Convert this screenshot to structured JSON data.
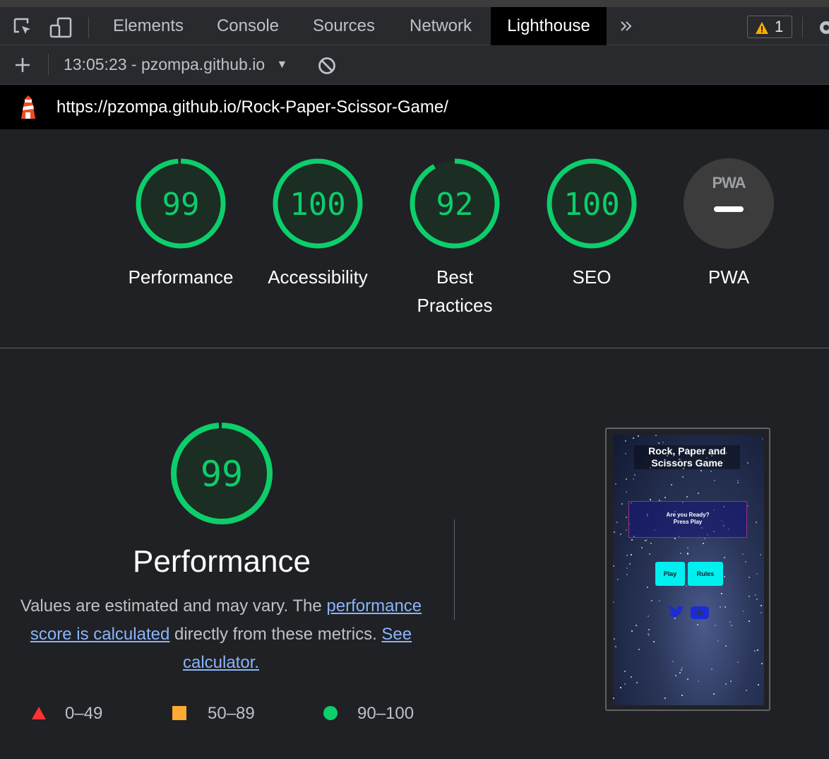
{
  "toolbar": {
    "tabs": [
      "Elements",
      "Console",
      "Sources",
      "Network",
      "Lighthouse"
    ],
    "more_icon": "chevron-double-right-icon",
    "warning_count": "1",
    "inspect_icon": "inspect-element-icon",
    "device_icon": "device-toggle-icon"
  },
  "report_bar": {
    "selector_label": "13:05:23 - pzompa.github.io",
    "add_icon": "plus-icon",
    "clear_icon": "block-icon"
  },
  "url": "https://pzompa.github.io/Rock-Paper-Scissor-Game/",
  "scores": [
    {
      "value": "99",
      "fraction": 0.99,
      "label": "Performance"
    },
    {
      "value": "100",
      "fraction": 1.0,
      "label": "Accessibility"
    },
    {
      "value": "92",
      "fraction": 0.92,
      "label_line1": "Best",
      "label_line2": "Practices"
    },
    {
      "value": "100",
      "fraction": 1.0,
      "label": "SEO"
    }
  ],
  "pwa": {
    "badge_text": "PWA",
    "label": "PWA"
  },
  "performance": {
    "score": "99",
    "fraction": 0.99,
    "title": "Performance",
    "desc_before": "Values are estimated and may vary. The ",
    "link1": "performance score is calculated",
    "desc_middle": " directly from these metrics. ",
    "link2": "See calculator."
  },
  "legend": [
    {
      "range": "0–49",
      "color": "#ff3333"
    },
    {
      "range": "50–89",
      "color": "#ffaa33"
    },
    {
      "range": "90–100",
      "color": "#0cce6b"
    }
  ],
  "thumbnail": {
    "title": "Rock, Paper and Scissors Game",
    "box_line1": "Are you Ready?",
    "box_line2": "Press Play",
    "play": "Play",
    "rules": "Rules",
    "icons": [
      "twitter-icon",
      "youtube-icon"
    ]
  },
  "colors": {
    "pass": "#0cce6b",
    "accent_link": "#8ab4f8"
  }
}
